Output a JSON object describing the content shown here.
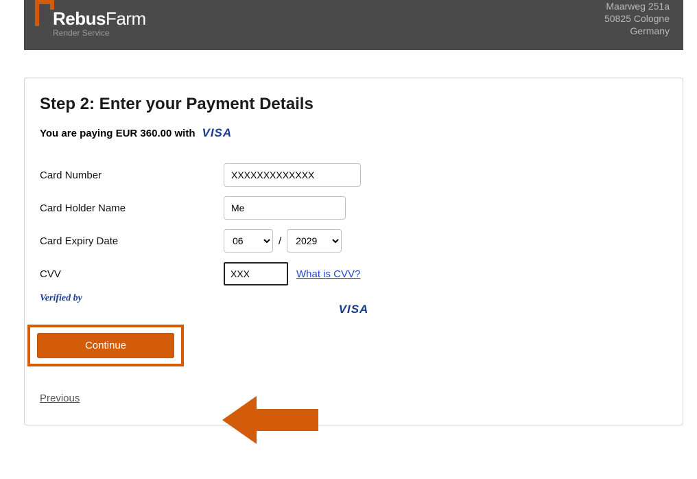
{
  "header": {
    "logo": {
      "brand": "Rebus",
      "suffix": "Farm",
      "tagline": "Render Service"
    },
    "address": {
      "line1": "Maarweg 251a",
      "line2": "50825 Cologne",
      "line3": "Germany"
    }
  },
  "checkout": {
    "title": "Step 2: Enter your Payment Details",
    "paying_prefix": "You are paying",
    "paying_amount": "EUR 360.00",
    "paying_suffix": "with",
    "payment_method_logo": "VISA",
    "labels": {
      "card_number": "Card Number",
      "card_holder": "Card Holder Name",
      "expiry": "Card Expiry Date",
      "cvv": "CVV"
    },
    "values": {
      "card_number": "XXXXXXXXXXXXX",
      "card_holder": "Me",
      "expiry_month": "06",
      "expiry_year": "2029",
      "cvv": "XXX"
    },
    "expiry_separator": "/",
    "cvv_help": "What is CVV?",
    "verified_by": "Verified by",
    "verified_logo": "VISA",
    "continue_label": "Continue",
    "previous_label": "Previous"
  }
}
